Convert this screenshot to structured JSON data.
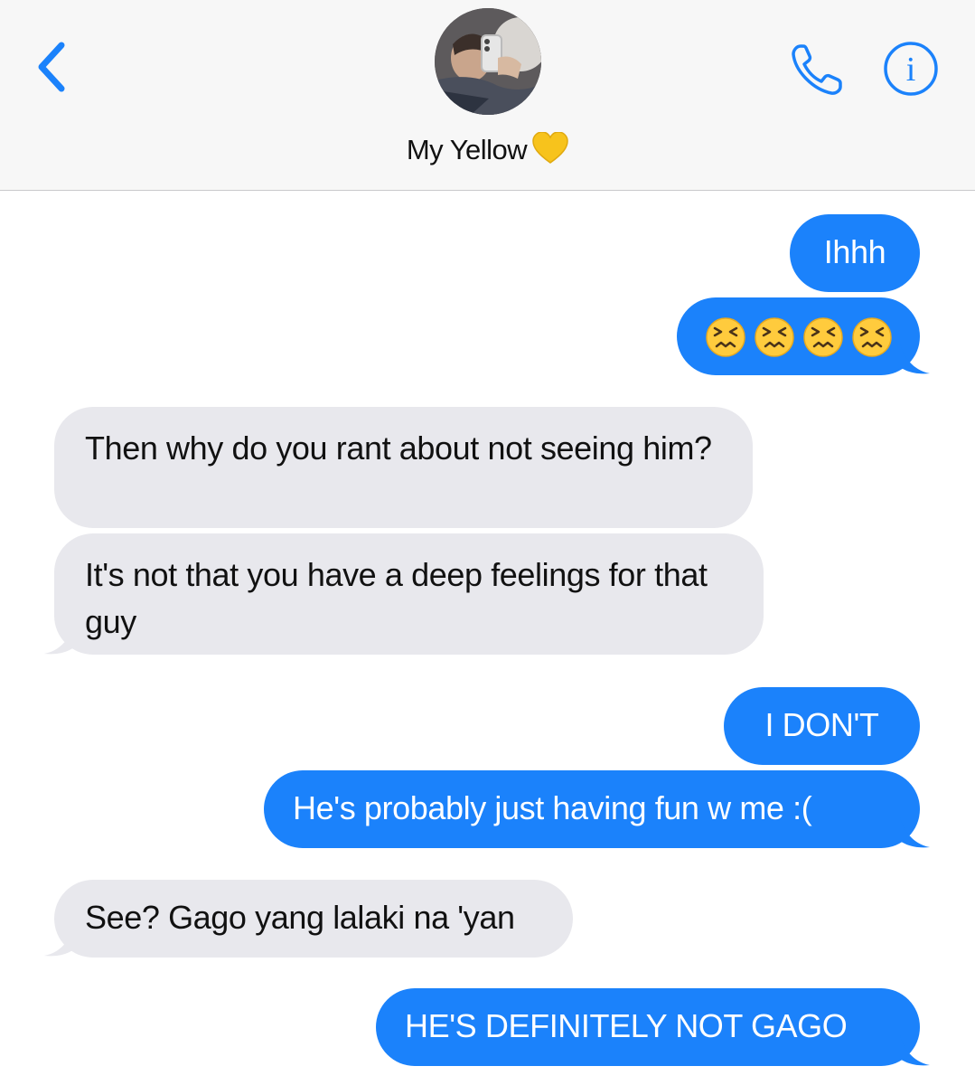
{
  "header": {
    "contact_name": "My Yellow",
    "contact_emoji": "yellow-heart-icon",
    "back_icon": "chevron-left-icon",
    "call_icon": "phone-icon",
    "info_icon": "info-icon",
    "info_glyph": "i"
  },
  "colors": {
    "sent_bubble": "#1b82fb",
    "received_bubble": "#e8e8ed",
    "accent": "#1b82fb",
    "heart": "#f7c31c"
  },
  "messages": [
    {
      "from": "me",
      "text": "Ihhh"
    },
    {
      "from": "me",
      "text": "😣😣😣😣",
      "emoji": "persevering-face-icon"
    },
    {
      "from": "them",
      "text": "Then why do you rant about not seeing him?"
    },
    {
      "from": "them",
      "text": "It's not that you have a deep feelings for that guy"
    },
    {
      "from": "me",
      "text": "I DON'T"
    },
    {
      "from": "me",
      "text": "He's probably just having fun w me :("
    },
    {
      "from": "them",
      "text": "See? Gago yang lalaki na 'yan"
    },
    {
      "from": "me",
      "text": "HE'S DEFINITELY NOT GAGO"
    }
  ]
}
